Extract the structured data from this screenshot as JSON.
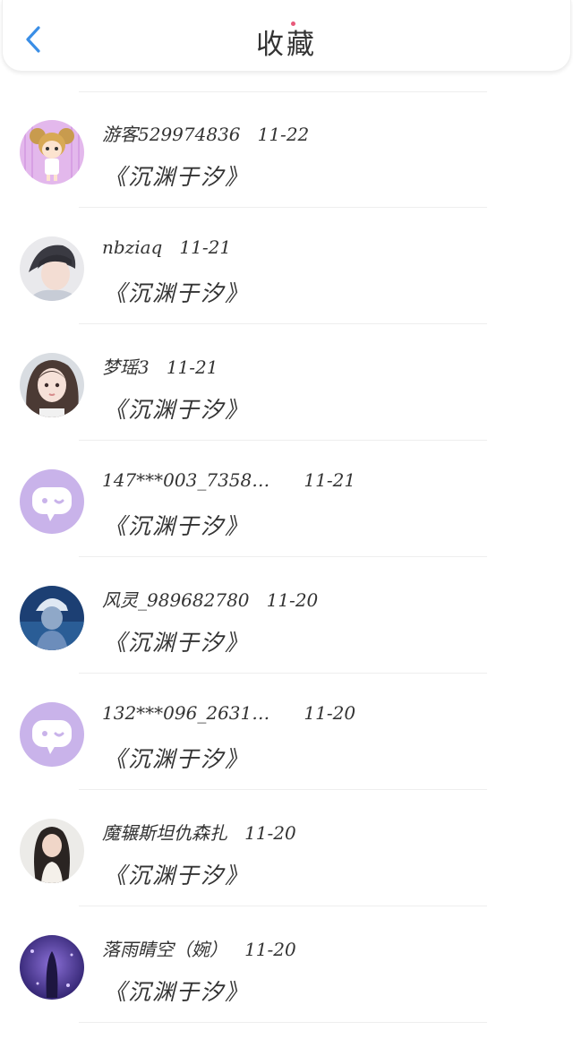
{
  "header": {
    "title": "收藏"
  },
  "items": [
    {
      "user": "游客529974836",
      "date": "11-22",
      "title": "《沉渊于汐》",
      "avatar": "cartoon-girl-avatar"
    },
    {
      "user": "nbziaq",
      "date": "11-21",
      "title": "《沉渊于汐》",
      "avatar": "boy-photo-avatar"
    },
    {
      "user": "梦瑶3",
      "date": "11-21",
      "title": "《沉渊于汐》",
      "avatar": "girl-photo-avatar"
    },
    {
      "user": "147***003_7358…",
      "date": "11-21",
      "title": "《沉渊于汐》",
      "avatar": "default-chat-avatar"
    },
    {
      "user": "风灵_989682780",
      "date": "11-20",
      "title": "《沉渊于汐》",
      "avatar": "cap-girl-photo-avatar"
    },
    {
      "user": "132***096_2631…",
      "date": "11-20",
      "title": "《沉渊于汐》",
      "avatar": "default-chat-avatar"
    },
    {
      "user": "魔辗斯坦仇森扎",
      "date": "11-20",
      "title": "《沉渊于汐》",
      "avatar": "longhair-girl-photo-avatar"
    },
    {
      "user": "落雨睛空（婉）",
      "date": "11-20",
      "title": "《沉渊于汐》",
      "avatar": "purple-night-photo-avatar"
    }
  ],
  "colors": {
    "accent": "#3a8ee6",
    "default_avatar_bg": "#c9b3ea"
  }
}
